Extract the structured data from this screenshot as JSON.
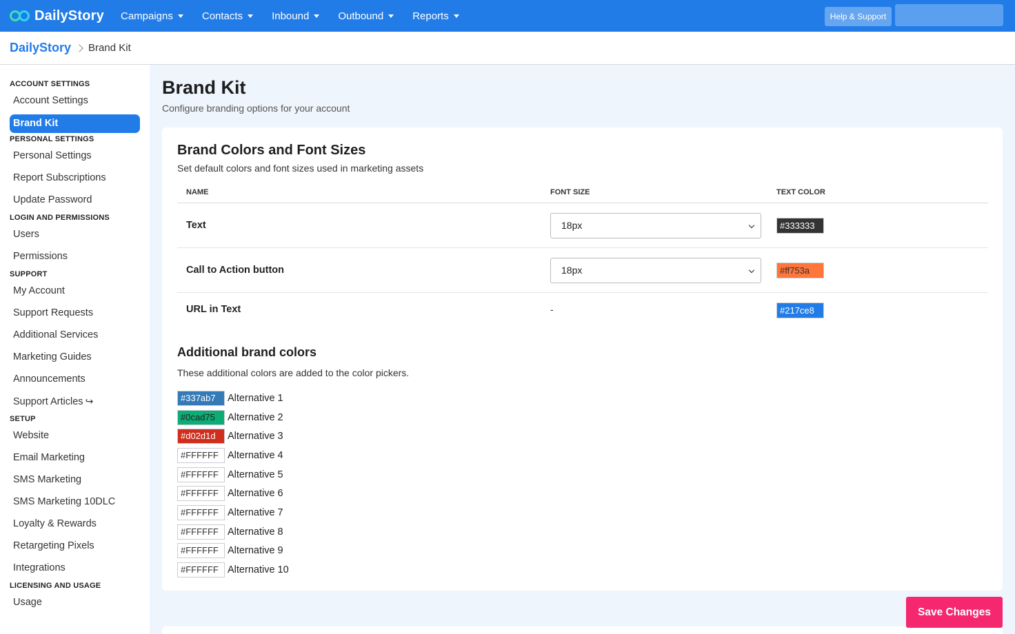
{
  "header": {
    "logo_text": "DailyStory",
    "nav": [
      {
        "label": "Campaigns"
      },
      {
        "label": "Contacts"
      },
      {
        "label": "Inbound"
      },
      {
        "label": "Outbound"
      },
      {
        "label": "Reports"
      }
    ],
    "help_label": "Help & Support",
    "brand_color": "#217ce8"
  },
  "breadcrumb": {
    "root": "DailyStory",
    "current": "Brand Kit"
  },
  "sidebar": {
    "sections": [
      {
        "title": "ACCOUNT SETTINGS",
        "items": [
          "Account Settings",
          "Brand Kit"
        ]
      },
      {
        "title": "PERSONAL SETTINGS",
        "items": [
          "Personal Settings",
          "Report Subscriptions",
          "Update Password"
        ]
      },
      {
        "title": "LOGIN AND PERMISSIONS",
        "items": [
          "Users",
          "Permissions"
        ]
      },
      {
        "title": "SUPPORT",
        "items": [
          "My Account",
          "Support Requests",
          "Additional Services",
          "Marketing Guides",
          "Announcements",
          "Support Articles"
        ]
      },
      {
        "title": "SETUP",
        "items": [
          "Website",
          "Email Marketing",
          "SMS Marketing",
          "SMS Marketing 10DLC",
          "Loyalty & Rewards",
          "Retargeting Pixels",
          "Integrations"
        ]
      },
      {
        "title": "LICENSING AND USAGE",
        "items": [
          "Usage"
        ]
      }
    ],
    "active_item": "Brand Kit",
    "external_icon": "external-link-icon"
  },
  "main": {
    "title": "Brand Kit",
    "subtitle": "Configure branding options for your account",
    "card": {
      "title": "Brand Colors and Font Sizes",
      "subtitle": "Set default colors and font sizes used in marketing assets",
      "columns": {
        "name": "NAME",
        "font_size": "FONT SIZE",
        "text_color": "TEXT COLOR"
      },
      "rows": [
        {
          "name": "Text",
          "font_size": "18px",
          "color": "#333333",
          "text_on": "#ffffff"
        },
        {
          "name": "Call to Action button",
          "font_size": "18px",
          "color": "#ff753a",
          "text_on": "#333333"
        },
        {
          "name": "URL in Text",
          "font_size": "-",
          "color": "#217ce8",
          "text_on": "#ffffff"
        }
      ],
      "additional": {
        "title": "Additional brand colors",
        "subtitle": "These additional colors are added to the color pickers.",
        "items": [
          {
            "color": "#337ab7",
            "label": "Alternative 1",
            "text_on": "#ffffff"
          },
          {
            "color": "#0cad75",
            "label": "Alternative 2",
            "text_on": "#222222"
          },
          {
            "color": "#d02d1d",
            "label": "Alternative 3",
            "text_on": "#ffffff"
          },
          {
            "color": "#FFFFFF",
            "label": "Alternative 4",
            "text_on": "#333333"
          },
          {
            "color": "#FFFFFF",
            "label": "Alternative 5",
            "text_on": "#333333"
          },
          {
            "color": "#FFFFFF",
            "label": "Alternative 6",
            "text_on": "#333333"
          },
          {
            "color": "#FFFFFF",
            "label": "Alternative 7",
            "text_on": "#333333"
          },
          {
            "color": "#FFFFFF",
            "label": "Alternative 8",
            "text_on": "#333333"
          },
          {
            "color": "#FFFFFF",
            "label": "Alternative 9",
            "text_on": "#333333"
          },
          {
            "color": "#FFFFFF",
            "label": "Alternative 10",
            "text_on": "#333333"
          }
        ]
      }
    },
    "save_label": "Save Changes",
    "save_color": "#f5276f"
  }
}
